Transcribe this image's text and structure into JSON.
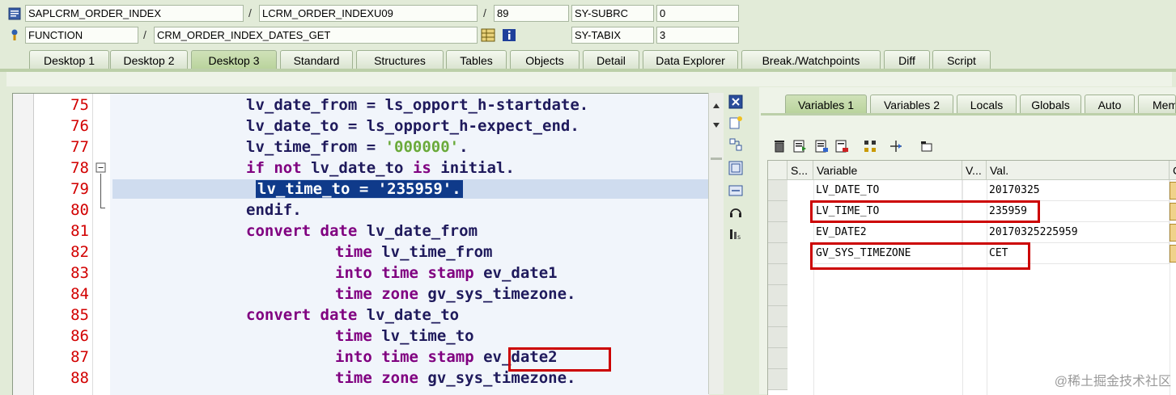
{
  "header": {
    "row1": {
      "program": "SAPLCRM_ORDER_INDEX",
      "include": "LCRM_ORDER_INDEXU09",
      "line": "89",
      "sys_label": "SY-SUBRC",
      "sys_value": "0"
    },
    "row2": {
      "type": "FUNCTION",
      "name": "CRM_ORDER_INDEX_DATES_GET",
      "sys_label": "SY-TABIX",
      "sys_value": "3"
    },
    "slash": "/"
  },
  "tabs": [
    {
      "label": "Desktop 1"
    },
    {
      "label": "Desktop 2"
    },
    {
      "label": "Desktop 3"
    },
    {
      "label": "Standard"
    },
    {
      "label": "Structures"
    },
    {
      "label": "Tables"
    },
    {
      "label": "Objects"
    },
    {
      "label": "Detail"
    },
    {
      "label": "Data Explorer"
    },
    {
      "label": "Break./Watchpoints"
    },
    {
      "label": "Diff"
    },
    {
      "label": "Script"
    }
  ],
  "active_tab": "Desktop 3",
  "code": {
    "lines": [
      {
        "no": "75",
        "text": "lv_date_from = ls_opport_h-startdate."
      },
      {
        "no": "76",
        "text": "lv_date_to = ls_opport_h-expect_end."
      },
      {
        "no": "77",
        "text": "lv_time_from = '000000'."
      },
      {
        "no": "78",
        "text": "if not lv_date_to is initial."
      },
      {
        "no": "79",
        "text": "lv_time_to = '235959'."
      },
      {
        "no": "80",
        "text": "endif."
      },
      {
        "no": "81",
        "text": "convert date lv_date_from"
      },
      {
        "no": "82",
        "text": "time lv_time_from"
      },
      {
        "no": "83",
        "text": "into time stamp ev_date1"
      },
      {
        "no": "84",
        "text": "time zone gv_sys_timezone."
      },
      {
        "no": "85",
        "text": "convert date lv_date_to"
      },
      {
        "no": "86",
        "text": "time lv_time_to"
      },
      {
        "no": "87",
        "text": "into time stamp ev_date2"
      },
      {
        "no": "88",
        "text": "time zone gv_sys_timezone."
      }
    ]
  },
  "variables": {
    "tabs": [
      {
        "label": "Variables 1"
      },
      {
        "label": "Variables 2"
      },
      {
        "label": "Locals"
      },
      {
        "label": "Globals"
      },
      {
        "label": "Auto"
      },
      {
        "label": "Mem"
      }
    ],
    "columns": {
      "s": "S...",
      "variable": "Variable",
      "v": "V...",
      "val": "Val.",
      "c": "C"
    },
    "rows": [
      {
        "variable": "LV_DATE_TO",
        "val": "20170325"
      },
      {
        "variable": "LV_TIME_TO",
        "val": "235959"
      },
      {
        "variable": "EV_DATE2",
        "val": "20170325225959"
      },
      {
        "variable": "GV_SYS_TIMEZONE",
        "val": "CET"
      }
    ]
  },
  "watermark": "@稀土掘金技术社区",
  "colors": {
    "keyword": "#800080",
    "identifier": "#1f1a5c",
    "string": "#6aaa3a",
    "line_number": "#d20000",
    "highlight": "#cc0000",
    "tab_active": "#b9d39c"
  }
}
